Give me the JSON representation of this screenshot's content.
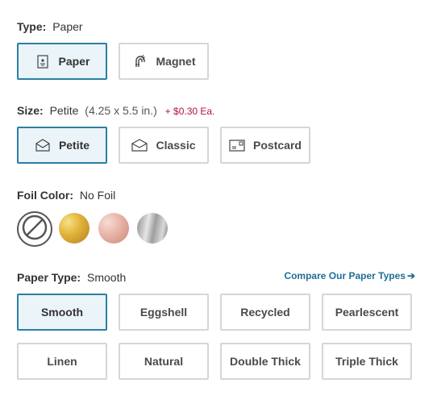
{
  "type_section": {
    "label": "Type:",
    "value": "Paper",
    "options": [
      {
        "label": "Paper",
        "icon": "paper-card-icon",
        "selected": true
      },
      {
        "label": "Magnet",
        "icon": "magnet-icon",
        "selected": false
      }
    ]
  },
  "size_section": {
    "label": "Size:",
    "value": "Petite",
    "dimensions": "(4.25 x 5.5 in.)",
    "price": "+ $0.30 Ea.",
    "options": [
      {
        "label": "Petite",
        "icon": "envelope-icon",
        "selected": true
      },
      {
        "label": "Classic",
        "icon": "envelope-icon",
        "selected": false
      },
      {
        "label": "Postcard",
        "icon": "postcard-icon",
        "selected": false
      }
    ]
  },
  "foil_section": {
    "label": "Foil Color:",
    "value": "No Foil",
    "swatches": [
      "No Foil",
      "Gold",
      "Rose Gold",
      "Silver"
    ],
    "colors": {
      "gold": "#e3b53c",
      "rose": "#e7b3a5",
      "silver": "#bdbdbd"
    }
  },
  "paper_type_section": {
    "label": "Paper Type:",
    "value": "Smooth",
    "compare_link": "Compare Our Paper Types",
    "options": [
      {
        "label": "Smooth",
        "selected": true
      },
      {
        "label": "Eggshell",
        "selected": false
      },
      {
        "label": "Recycled",
        "selected": false
      },
      {
        "label": "Pearlescent",
        "selected": false
      },
      {
        "label": "Linen",
        "selected": false
      },
      {
        "label": "Natural",
        "selected": false
      },
      {
        "label": "Double Thick",
        "selected": false
      },
      {
        "label": "Triple Thick",
        "selected": false
      }
    ]
  },
  "colors": {
    "accent": "#2a7fa3",
    "selected_bg": "#eaf4f9",
    "price": "#b0143c",
    "link": "#1f6e96"
  }
}
